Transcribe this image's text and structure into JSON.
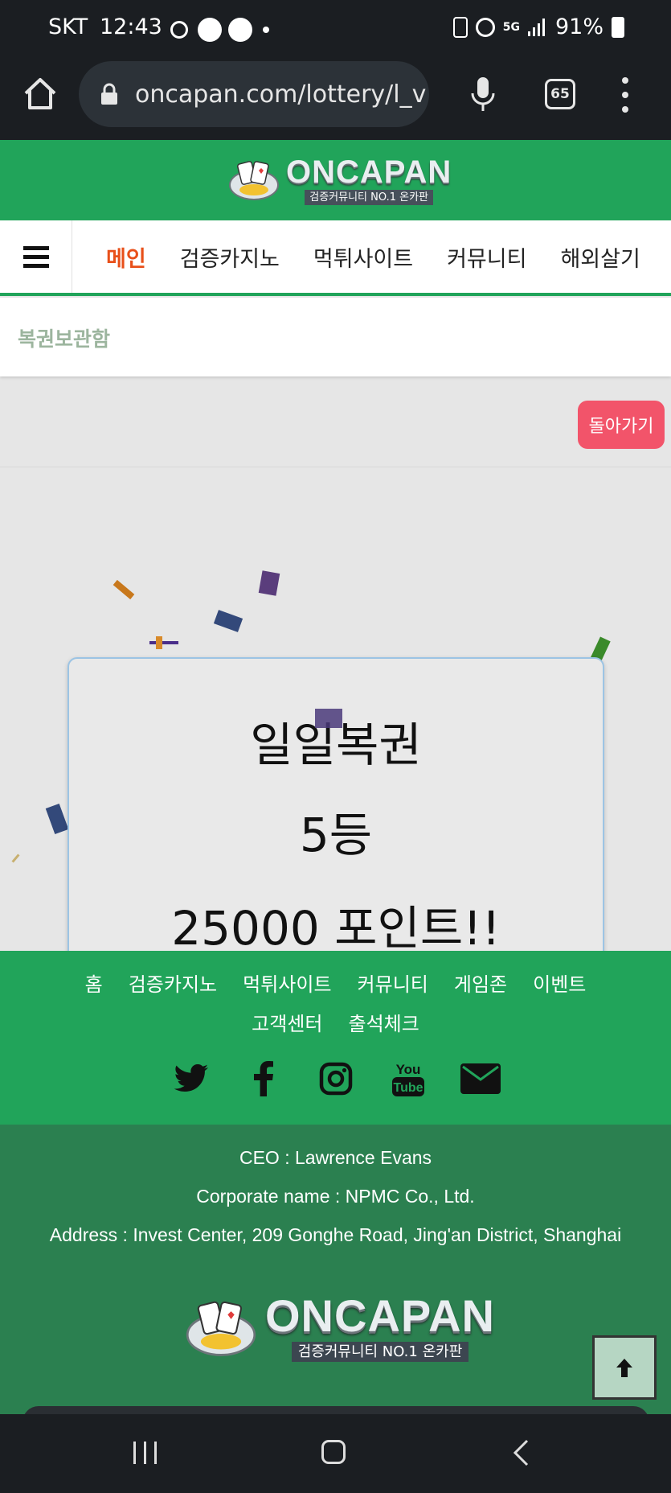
{
  "status_bar": {
    "carrier": "SKT",
    "time": "12:43",
    "battery": "91%"
  },
  "browser": {
    "url": "oncapan.com/lottery/l_v",
    "tab_count": "65"
  },
  "site": {
    "logo_name": "ONCAPAN",
    "logo_tagline": "검증커뮤니티 NO.1 온카판",
    "nav_items": [
      "메인",
      "검증카지노",
      "먹튀사이트",
      "커뮤니티",
      "해외살기"
    ],
    "breadcrumb": "복권보관함",
    "back_button": "돌아가기"
  },
  "prize": {
    "title": "일일복권",
    "rank": "5등",
    "points": "25000 포인트!!"
  },
  "footer": {
    "links": [
      "홈",
      "검증카지노",
      "먹튀사이트",
      "커뮤니티",
      "게임존",
      "이벤트",
      "고객센터",
      "출석체크"
    ],
    "social_icons": [
      "twitter-icon",
      "facebook-icon",
      "instagram-icon",
      "youtube-icon",
      "mail-icon"
    ],
    "ceo": "CEO : Lawrence Evans",
    "corporate": "Corporate name : NPMC Co., Ltd.",
    "address": "Address : Invest Center, 209 Gonghe Road, Jing'an District, Shanghai",
    "youtube_label": "You Tube"
  },
  "colors": {
    "brand_green": "#21a45a",
    "footer_dark_green": "#2b8050",
    "active_nav": "#e8501a",
    "back_button": "#f2546a"
  }
}
